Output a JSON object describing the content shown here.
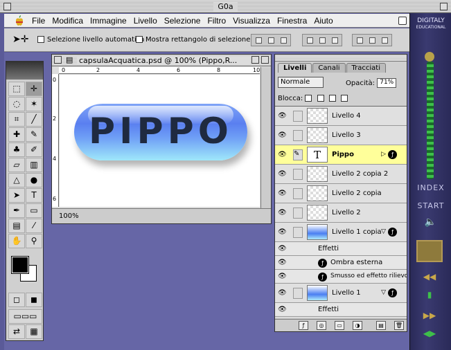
{
  "window": {
    "title": "G0a"
  },
  "menu": {
    "items": [
      "File",
      "Modifica",
      "Immagine",
      "Livello",
      "Selezione",
      "Filtro",
      "Visualizza",
      "Finestra",
      "Aiuto"
    ]
  },
  "options": {
    "auto_select_label": "Selezione livello automatica",
    "show_bounds_label": "Mostra rettangolo di selezione"
  },
  "document": {
    "title": "capsulaAcquatica.psd @ 100% (Pippo,R...",
    "zoom": "100%",
    "canvas_text": "PIPPO",
    "ruler_marks": [
      "0",
      "2",
      "4",
      "6",
      "8",
      "10"
    ]
  },
  "layers_panel": {
    "tabs": [
      "Livelli",
      "Canali",
      "Tracciati"
    ],
    "blend_mode": "Normale",
    "opacity_label": "Opacità:",
    "opacity_value": "71%",
    "lock_label": "Blocca:",
    "rows": [
      {
        "name": "Livello 4"
      },
      {
        "name": "Livello 3"
      },
      {
        "name": "Pippo"
      },
      {
        "name": "Livello 2 copia 2"
      },
      {
        "name": "Livello 2 copia"
      },
      {
        "name": "Livello 2"
      },
      {
        "name": "Livello 1 copia"
      },
      {
        "name": "Effetti"
      },
      {
        "name": "Ombra esterna"
      },
      {
        "name": "Smusso ed effetto rilievo"
      },
      {
        "name": "Livello 1"
      },
      {
        "name": "Effetti"
      }
    ]
  },
  "sidebar": {
    "brand": "DIGITALY",
    "brand_sub": "EDUCATIONAL",
    "index_label": "INDEX",
    "start_label": "START"
  }
}
